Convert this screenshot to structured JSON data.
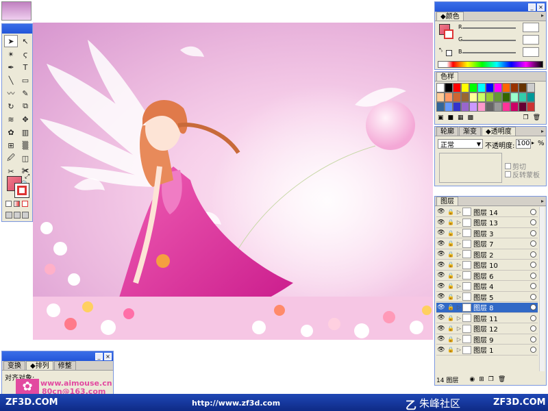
{
  "tools": {
    "icons": [
      "selection-arrow",
      "direct-select-arrow",
      "magic-wand",
      "lasso",
      "pen",
      "type",
      "line",
      "rectangle",
      "paintbrush",
      "pencil",
      "rotate",
      "scale",
      "warp",
      "free-transform",
      "symbol-sprayer",
      "graph",
      "mesh",
      "gradient",
      "eyedropper",
      "blend",
      "slice",
      "scissors",
      "hand",
      "zoom"
    ],
    "glyphs": [
      "➤",
      "↖",
      "✴",
      "ϛ",
      "✒",
      "T",
      "╲",
      "▭",
      "〰",
      "✎",
      "↻",
      "⧉",
      "≋",
      "✥",
      "✿",
      "▥",
      "⊞",
      "▒",
      "🖉",
      "◫",
      "✂",
      "✀",
      "✋",
      "🔍"
    ]
  },
  "color_panel": {
    "title": "颜色",
    "channels": [
      "R",
      "G",
      "B"
    ]
  },
  "swatches_panel": {
    "title": "色样",
    "colors": [
      "#ffffff",
      "#000000",
      "#ff0000",
      "#ffff00",
      "#00ff00",
      "#00ffff",
      "#0000ff",
      "#ff00ff",
      "#ff6600",
      "#993300",
      "#663300",
      "#cccccc",
      "#ffcc99",
      "#ff9966",
      "#cc6633",
      "#996633",
      "#ffff99",
      "#ccff66",
      "#99cc33",
      "#669933",
      "#336600",
      "#99ffcc",
      "#33ccaa",
      "#009999",
      "#336699",
      "#6699ff",
      "#3333cc",
      "#9966cc",
      "#cc99ff",
      "#ff99cc",
      "#666666",
      "#999999",
      "#ff3399",
      "#cc0066",
      "#660033",
      "#cc3333"
    ]
  },
  "transparency_panel": {
    "tabs": [
      "轮廓",
      "渐变",
      "透明度"
    ],
    "blend_mode": "正常",
    "opacity_label": "不透明度:",
    "opacity_value": "100",
    "opacity_unit": "%",
    "clip_label": "剪切",
    "invert_mask_label": "反转蒙板"
  },
  "layers_panel": {
    "title": "图层",
    "layers": [
      {
        "name": "图层 14",
        "selected": false
      },
      {
        "name": "图层 13",
        "selected": false
      },
      {
        "name": "图层 3",
        "selected": false
      },
      {
        "name": "图层 7",
        "selected": false
      },
      {
        "name": "图层 2",
        "selected": false
      },
      {
        "name": "图层 10",
        "selected": false
      },
      {
        "name": "图层 6",
        "selected": false
      },
      {
        "name": "图层 4",
        "selected": false
      },
      {
        "name": "图层 5",
        "selected": false
      },
      {
        "name": "图层 8",
        "selected": true
      },
      {
        "name": "图层 11",
        "selected": false
      },
      {
        "name": "图层 12",
        "selected": false
      },
      {
        "name": "图层 9",
        "selected": false
      },
      {
        "name": "图层 1",
        "selected": false
      }
    ],
    "footer_count": "14 图层"
  },
  "align_panel": {
    "tabs": [
      "变换",
      "排列",
      "修整"
    ],
    "label": "对齐对象:",
    "watermark_site": "www.aimouse.cn",
    "watermark_email": "80cn@163.com"
  },
  "banner": {
    "left_logo": "ZF3D.COM",
    "url": "http://www.zf3d.com",
    "community": "朱峰社区",
    "right_logo": "ZF3D.COM"
  },
  "colors": {
    "accent_blue": "#2456d8",
    "selection_blue": "#3169c6",
    "banner_blue": "#1f47b5",
    "canvas_pink": "#f7d0ea",
    "dress_magenta": "#e0389e"
  }
}
